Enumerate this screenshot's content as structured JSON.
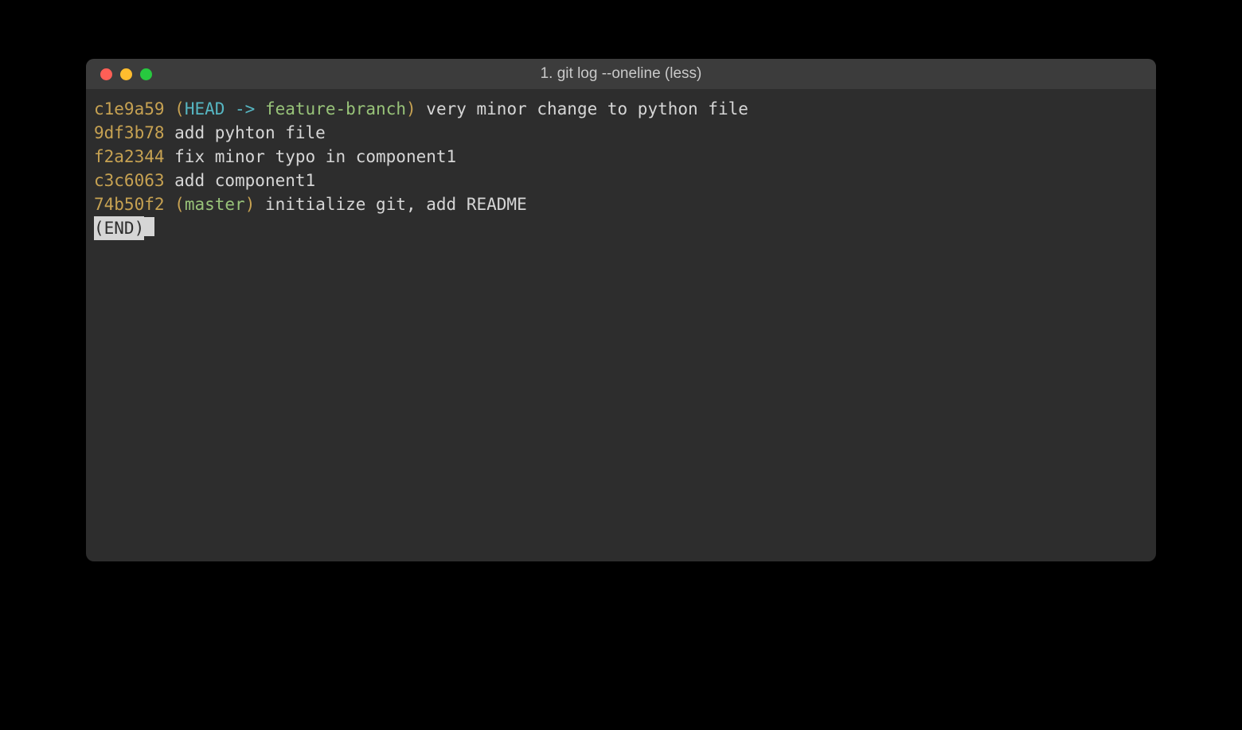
{
  "window": {
    "title": "1. git log --oneline (less)"
  },
  "commits": [
    {
      "hash": "c1e9a59",
      "refs": {
        "open": "(",
        "head": "HEAD -> ",
        "branch": "feature-branch",
        "close": ")"
      },
      "message": " very minor change to python file"
    },
    {
      "hash": "9df3b78",
      "message": " add pyhton file"
    },
    {
      "hash": "f2a2344",
      "message": " fix minor typo in component1"
    },
    {
      "hash": "c3c6063",
      "message": " add component1"
    },
    {
      "hash": "74b50f2",
      "refs": {
        "open": "(",
        "branch": "master",
        "close": ")"
      },
      "message": " initialize git, add README"
    }
  ],
  "pager": {
    "end": "(END)"
  }
}
